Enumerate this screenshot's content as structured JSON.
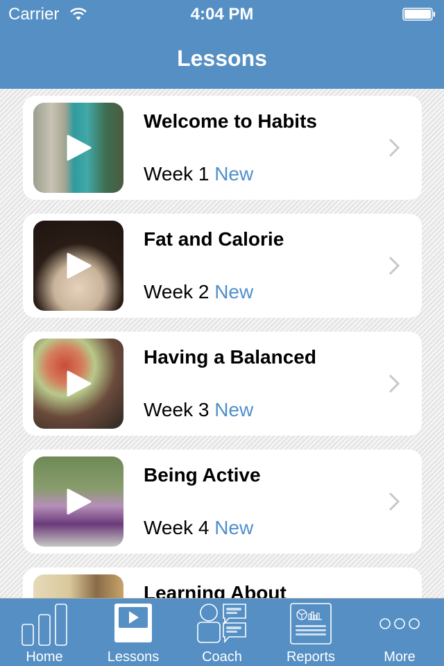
{
  "status_bar": {
    "carrier": "Carrier",
    "time": "4:04 PM"
  },
  "nav": {
    "title": "Lessons"
  },
  "lessons": [
    {
      "title": "Welcome to Habits",
      "week": "Week 1",
      "badge": "New"
    },
    {
      "title": "Fat and Calorie",
      "week": "Week 2",
      "badge": "New"
    },
    {
      "title": "Having a Balanced",
      "week": "Week 3",
      "badge": "New"
    },
    {
      "title": "Being Active",
      "week": "Week 4",
      "badge": "New"
    },
    {
      "title": "Learning About",
      "week": "",
      "badge": ""
    }
  ],
  "tabs": [
    {
      "label": "Home",
      "icon": "bar-chart-icon",
      "active": false
    },
    {
      "label": "Lessons",
      "icon": "video-play-icon",
      "active": true
    },
    {
      "label": "Coach",
      "icon": "coach-chat-icon",
      "active": false
    },
    {
      "label": "Reports",
      "icon": "report-icon",
      "active": false
    },
    {
      "label": "More",
      "icon": "more-dots-icon",
      "active": false
    }
  ],
  "colors": {
    "brand": "#558fc4",
    "badge": "#4f8fcb",
    "chevron": "#c7c7cc"
  }
}
